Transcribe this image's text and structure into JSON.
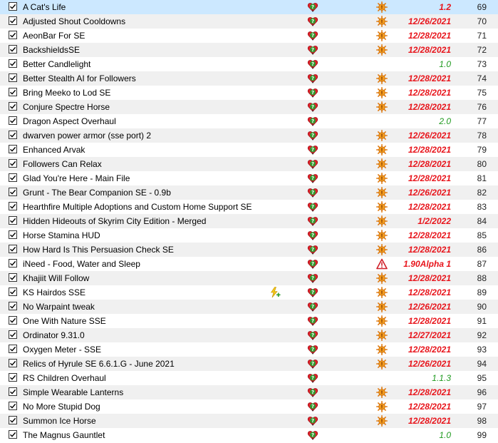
{
  "colors": {
    "outdated_version": "#e8141b",
    "current_version": "#1f9a1f",
    "selected_row": "#cce8ff",
    "alt_row": "#f0f0f0"
  },
  "mods": [
    {
      "name": "A Cat's Life",
      "version": "1.2",
      "version_status": "outdated",
      "priority": "69",
      "conflict_icon": "sun-warning-icon",
      "checked": true,
      "selected": true
    },
    {
      "name": "Adjusted Shout Cooldowns",
      "version": "12/26/2021",
      "version_status": "outdated",
      "priority": "70",
      "conflict_icon": "sun-warning-icon",
      "checked": true
    },
    {
      "name": "AeonBar For SE",
      "version": "12/28/2021",
      "version_status": "outdated",
      "priority": "71",
      "conflict_icon": "sun-warning-icon",
      "checked": true
    },
    {
      "name": "BackshieldsSE",
      "version": "12/28/2021",
      "version_status": "outdated",
      "priority": "72",
      "conflict_icon": "sun-warning-icon",
      "checked": true
    },
    {
      "name": "Better Candlelight",
      "version": "1.0",
      "version_status": "current",
      "priority": "73",
      "conflict_icon": "",
      "checked": true
    },
    {
      "name": "Better Stealth AI for Followers",
      "version": "12/28/2021",
      "version_status": "outdated",
      "priority": "74",
      "conflict_icon": "sun-warning-icon",
      "checked": true
    },
    {
      "name": "Bring Meeko to Lod SE",
      "version": "12/28/2021",
      "version_status": "outdated",
      "priority": "75",
      "conflict_icon": "sun-warning-icon",
      "checked": true
    },
    {
      "name": "Conjure Spectre Horse",
      "version": "12/28/2021",
      "version_status": "outdated",
      "priority": "76",
      "conflict_icon": "sun-warning-icon",
      "checked": true
    },
    {
      "name": "Dragon Aspect Overhaul",
      "version": "2.0",
      "version_status": "current",
      "priority": "77",
      "conflict_icon": "",
      "checked": true
    },
    {
      "name": "dwarven power armor (sse port) 2",
      "version": "12/26/2021",
      "version_status": "outdated",
      "priority": "78",
      "conflict_icon": "sun-warning-icon",
      "checked": true
    },
    {
      "name": "Enhanced Arvak",
      "version": "12/28/2021",
      "version_status": "outdated",
      "priority": "79",
      "conflict_icon": "sun-warning-icon",
      "checked": true
    },
    {
      "name": "Followers Can Relax",
      "version": "12/28/2021",
      "version_status": "outdated",
      "priority": "80",
      "conflict_icon": "sun-warning-icon",
      "checked": true
    },
    {
      "name": "Glad You're Here - Main File",
      "version": "12/28/2021",
      "version_status": "outdated",
      "priority": "81",
      "conflict_icon": "sun-warning-icon",
      "checked": true
    },
    {
      "name": "Grunt - The Bear Companion SE - 0.9b",
      "version": "12/26/2021",
      "version_status": "outdated",
      "priority": "82",
      "conflict_icon": "sun-warning-icon",
      "checked": true
    },
    {
      "name": "Hearthfire Multiple Adoptions and Custom Home Support SE",
      "version": "12/28/2021",
      "version_status": "outdated",
      "priority": "83",
      "conflict_icon": "sun-warning-icon",
      "checked": true
    },
    {
      "name": "Hidden Hideouts of Skyrim City Edition - Merged",
      "version": "1/2/2022",
      "version_status": "outdated",
      "priority": "84",
      "conflict_icon": "sun-warning-icon",
      "checked": true
    },
    {
      "name": "Horse Stamina HUD",
      "version": "12/28/2021",
      "version_status": "outdated",
      "priority": "85",
      "conflict_icon": "sun-warning-icon",
      "checked": true
    },
    {
      "name": "How Hard Is This Persuasion Check SE",
      "version": "12/28/2021",
      "version_status": "outdated",
      "priority": "86",
      "conflict_icon": "sun-warning-icon",
      "checked": true
    },
    {
      "name": "iNeed - Food, Water and Sleep",
      "version": "1.90Alpha 1",
      "version_status": "outdated",
      "priority": "87",
      "conflict_icon": "warning-triangle-icon",
      "checked": true
    },
    {
      "name": "Khajiit Will Follow",
      "version": "12/28/2021",
      "version_status": "outdated",
      "priority": "88",
      "conflict_icon": "sun-warning-icon",
      "checked": true
    },
    {
      "name": "KS Hairdos SSE",
      "version": "12/28/2021",
      "version_status": "outdated",
      "priority": "89",
      "conflict_icon": "sun-warning-icon",
      "checked": true,
      "extra_icon": "lightning-plus-icon"
    },
    {
      "name": "No Warpaint tweak",
      "version": "12/26/2021",
      "version_status": "outdated",
      "priority": "90",
      "conflict_icon": "sun-warning-icon",
      "checked": true
    },
    {
      "name": "One With Nature SSE",
      "version": "12/28/2021",
      "version_status": "outdated",
      "priority": "91",
      "conflict_icon": "sun-warning-icon",
      "checked": true
    },
    {
      "name": "Ordinator 9.31.0",
      "version": "12/27/2021",
      "version_status": "outdated",
      "priority": "92",
      "conflict_icon": "sun-warning-icon",
      "checked": true
    },
    {
      "name": "Oxygen Meter - SSE",
      "version": "12/28/2021",
      "version_status": "outdated",
      "priority": "93",
      "conflict_icon": "sun-warning-icon",
      "checked": true
    },
    {
      "name": "Relics of Hyrule SE 6.6.1.G - June 2021",
      "version": "12/26/2021",
      "version_status": "outdated",
      "priority": "94",
      "conflict_icon": "sun-warning-icon",
      "checked": true
    },
    {
      "name": "RS Children Overhaul",
      "version": "1.1.3",
      "version_status": "current",
      "priority": "95",
      "conflict_icon": "",
      "checked": true
    },
    {
      "name": "Simple Wearable Lanterns",
      "version": "12/28/2021",
      "version_status": "outdated",
      "priority": "96",
      "conflict_icon": "sun-warning-icon",
      "checked": true
    },
    {
      "name": "No More Stupid Dog",
      "version": "12/28/2021",
      "version_status": "outdated",
      "priority": "97",
      "conflict_icon": "sun-warning-icon",
      "checked": true
    },
    {
      "name": "Summon Ice Horse",
      "version": "12/28/2021",
      "version_status": "outdated",
      "priority": "98",
      "conflict_icon": "sun-warning-icon",
      "checked": true
    },
    {
      "name": "The Magnus Gauntlet",
      "version": "1.0",
      "version_status": "current",
      "priority": "99",
      "conflict_icon": "",
      "checked": true
    }
  ]
}
